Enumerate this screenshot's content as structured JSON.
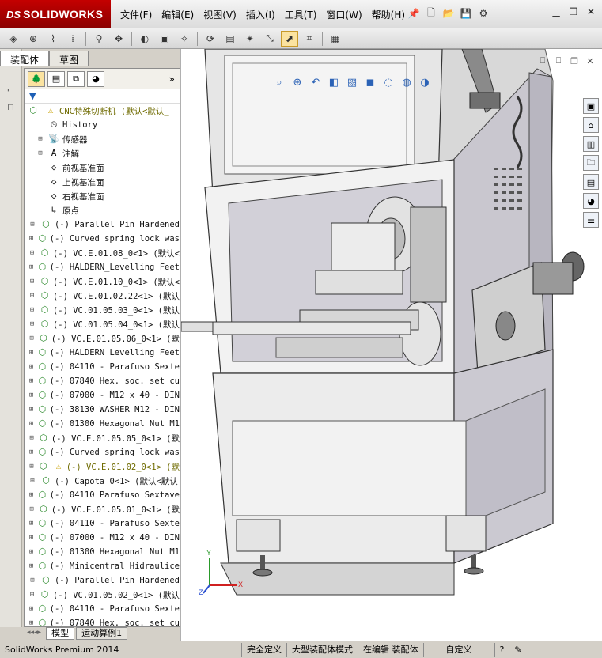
{
  "app": {
    "logo_ds": "DS",
    "logo_name": "SOLIDWORKS"
  },
  "menu": [
    {
      "label": "文件(F)"
    },
    {
      "label": "编辑(E)"
    },
    {
      "label": "视图(V)"
    },
    {
      "label": "插入(I)"
    },
    {
      "label": "工具(T)"
    },
    {
      "label": "窗口(W)"
    },
    {
      "label": "帮助(H)"
    }
  ],
  "panel_tabs": {
    "assembly": "装配体",
    "sketch": "草图"
  },
  "tree": {
    "root": "CNC特殊切断机  (默认<默认_",
    "items": [
      {
        "label": "History",
        "icon": "history-icon"
      },
      {
        "label": "传感器",
        "icon": "sensor-icon"
      },
      {
        "label": "注解",
        "icon": "annotation-icon"
      },
      {
        "label": "前视基准面",
        "icon": "plane-icon"
      },
      {
        "label": "上视基准面",
        "icon": "plane-icon"
      },
      {
        "label": "右视基准面",
        "icon": "plane-icon"
      },
      {
        "label": "原点",
        "icon": "origin-icon"
      },
      {
        "label": "(-) Parallel Pin Hardened",
        "icon": "part-icon"
      },
      {
        "label": "(-) Curved spring lock was",
        "icon": "part-icon"
      },
      {
        "label": "(-) VC.E.01.08_0<1> (默认<",
        "icon": "part-icon"
      },
      {
        "label": "(-) HALDERN_Levelling Feet",
        "icon": "part-icon"
      },
      {
        "label": "(-) VC.E.01.10_0<1> (默认<",
        "icon": "part-icon"
      },
      {
        "label": "(-) VC.E.01.02.22<1> (默认",
        "icon": "part-icon"
      },
      {
        "label": "(-) VC.01.05.03_0<1> (默认",
        "icon": "part-icon"
      },
      {
        "label": "(-) VC.01.05.04_0<1> (默认",
        "icon": "part-icon"
      },
      {
        "label": "(-) VC.E.01.05.06_0<1> (默",
        "icon": "part-icon"
      },
      {
        "label": "(-) HALDERN_Levelling Feet",
        "icon": "part-icon"
      },
      {
        "label": "(-) 04110 - Parafuso Sexte",
        "icon": "part-icon"
      },
      {
        "label": "(-) 07840 Hex. soc. set cu",
        "icon": "part-icon"
      },
      {
        "label": "(-) 07000 - M12 x 40 - DIN",
        "icon": "part-icon"
      },
      {
        "label": "(-) 38130 WASHER M12 - DIN",
        "icon": "part-icon"
      },
      {
        "label": "(-) 01300 Hexagonal Nut M1",
        "icon": "part-icon"
      },
      {
        "label": "(-) VC.E.01.05.05_0<1> (默",
        "icon": "part-icon"
      },
      {
        "label": "(-) Curved spring lock was",
        "icon": "part-icon"
      },
      {
        "label": "(-) VC.E.01.02_0<1> (默",
        "icon": "warn-icon",
        "warn": true
      },
      {
        "label": "(-) Capota_0<1> (默认<默认",
        "icon": "part-icon"
      },
      {
        "label": "(-) 04110 Parafuso Sextave",
        "icon": "part-icon"
      },
      {
        "label": "(-) VC.E.01.05.01_0<1> (默",
        "icon": "part-icon"
      },
      {
        "label": "(-) 04110 - Parafuso Sexte",
        "icon": "part-icon"
      },
      {
        "label": "(-) 07000 - M12 x 40 - DIN",
        "icon": "part-icon"
      },
      {
        "label": "(-) 01300 Hexagonal Nut M1",
        "icon": "part-icon"
      },
      {
        "label": "(-) Minicentral Hidraulice",
        "icon": "part-icon"
      },
      {
        "label": "(-) Parallel Pin Hardened",
        "icon": "part-icon"
      },
      {
        "label": "(-) VC.01.05.02_0<1> (默认",
        "icon": "part-icon"
      },
      {
        "label": "(-) 04110 - Parafuso Sexte",
        "icon": "part-icon"
      },
      {
        "label": "(-) 07840 Hex. soc. set cu",
        "icon": "part-icon"
      }
    ]
  },
  "bottom_tabs": {
    "model": "模型",
    "motion": "运动算例1"
  },
  "status": {
    "version": "SolidWorks Premium 2014",
    "defined": "完全定义",
    "mode": "大型装配体模式",
    "editing": "在编辑 装配体",
    "custom": "自定义"
  },
  "triad": {
    "x": "X",
    "y": "Y",
    "z": "Z"
  },
  "colors": {
    "brand": "#b00000",
    "part_green": "#2e8b2e",
    "warning": "#c8a000",
    "machine_panel": "#cfcfcf",
    "machine_dark": "#555555"
  }
}
